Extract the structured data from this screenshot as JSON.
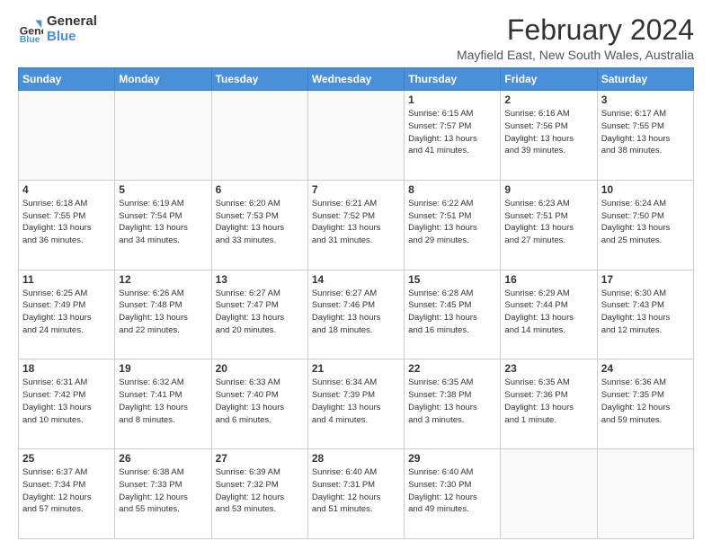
{
  "logo": {
    "line1": "General",
    "line2": "Blue"
  },
  "title": "February 2024",
  "subtitle": "Mayfield East, New South Wales, Australia",
  "header_days": [
    "Sunday",
    "Monday",
    "Tuesday",
    "Wednesday",
    "Thursday",
    "Friday",
    "Saturday"
  ],
  "weeks": [
    [
      {
        "day": "",
        "info": ""
      },
      {
        "day": "",
        "info": ""
      },
      {
        "day": "",
        "info": ""
      },
      {
        "day": "",
        "info": ""
      },
      {
        "day": "1",
        "info": "Sunrise: 6:15 AM\nSunset: 7:57 PM\nDaylight: 13 hours\nand 41 minutes."
      },
      {
        "day": "2",
        "info": "Sunrise: 6:16 AM\nSunset: 7:56 PM\nDaylight: 13 hours\nand 39 minutes."
      },
      {
        "day": "3",
        "info": "Sunrise: 6:17 AM\nSunset: 7:55 PM\nDaylight: 13 hours\nand 38 minutes."
      }
    ],
    [
      {
        "day": "4",
        "info": "Sunrise: 6:18 AM\nSunset: 7:55 PM\nDaylight: 13 hours\nand 36 minutes."
      },
      {
        "day": "5",
        "info": "Sunrise: 6:19 AM\nSunset: 7:54 PM\nDaylight: 13 hours\nand 34 minutes."
      },
      {
        "day": "6",
        "info": "Sunrise: 6:20 AM\nSunset: 7:53 PM\nDaylight: 13 hours\nand 33 minutes."
      },
      {
        "day": "7",
        "info": "Sunrise: 6:21 AM\nSunset: 7:52 PM\nDaylight: 13 hours\nand 31 minutes."
      },
      {
        "day": "8",
        "info": "Sunrise: 6:22 AM\nSunset: 7:51 PM\nDaylight: 13 hours\nand 29 minutes."
      },
      {
        "day": "9",
        "info": "Sunrise: 6:23 AM\nSunset: 7:51 PM\nDaylight: 13 hours\nand 27 minutes."
      },
      {
        "day": "10",
        "info": "Sunrise: 6:24 AM\nSunset: 7:50 PM\nDaylight: 13 hours\nand 25 minutes."
      }
    ],
    [
      {
        "day": "11",
        "info": "Sunrise: 6:25 AM\nSunset: 7:49 PM\nDaylight: 13 hours\nand 24 minutes."
      },
      {
        "day": "12",
        "info": "Sunrise: 6:26 AM\nSunset: 7:48 PM\nDaylight: 13 hours\nand 22 minutes."
      },
      {
        "day": "13",
        "info": "Sunrise: 6:27 AM\nSunset: 7:47 PM\nDaylight: 13 hours\nand 20 minutes."
      },
      {
        "day": "14",
        "info": "Sunrise: 6:27 AM\nSunset: 7:46 PM\nDaylight: 13 hours\nand 18 minutes."
      },
      {
        "day": "15",
        "info": "Sunrise: 6:28 AM\nSunset: 7:45 PM\nDaylight: 13 hours\nand 16 minutes."
      },
      {
        "day": "16",
        "info": "Sunrise: 6:29 AM\nSunset: 7:44 PM\nDaylight: 13 hours\nand 14 minutes."
      },
      {
        "day": "17",
        "info": "Sunrise: 6:30 AM\nSunset: 7:43 PM\nDaylight: 13 hours\nand 12 minutes."
      }
    ],
    [
      {
        "day": "18",
        "info": "Sunrise: 6:31 AM\nSunset: 7:42 PM\nDaylight: 13 hours\nand 10 minutes."
      },
      {
        "day": "19",
        "info": "Sunrise: 6:32 AM\nSunset: 7:41 PM\nDaylight: 13 hours\nand 8 minutes."
      },
      {
        "day": "20",
        "info": "Sunrise: 6:33 AM\nSunset: 7:40 PM\nDaylight: 13 hours\nand 6 minutes."
      },
      {
        "day": "21",
        "info": "Sunrise: 6:34 AM\nSunset: 7:39 PM\nDaylight: 13 hours\nand 4 minutes."
      },
      {
        "day": "22",
        "info": "Sunrise: 6:35 AM\nSunset: 7:38 PM\nDaylight: 13 hours\nand 3 minutes."
      },
      {
        "day": "23",
        "info": "Sunrise: 6:35 AM\nSunset: 7:36 PM\nDaylight: 13 hours\nand 1 minute."
      },
      {
        "day": "24",
        "info": "Sunrise: 6:36 AM\nSunset: 7:35 PM\nDaylight: 12 hours\nand 59 minutes."
      }
    ],
    [
      {
        "day": "25",
        "info": "Sunrise: 6:37 AM\nSunset: 7:34 PM\nDaylight: 12 hours\nand 57 minutes."
      },
      {
        "day": "26",
        "info": "Sunrise: 6:38 AM\nSunset: 7:33 PM\nDaylight: 12 hours\nand 55 minutes."
      },
      {
        "day": "27",
        "info": "Sunrise: 6:39 AM\nSunset: 7:32 PM\nDaylight: 12 hours\nand 53 minutes."
      },
      {
        "day": "28",
        "info": "Sunrise: 6:40 AM\nSunset: 7:31 PM\nDaylight: 12 hours\nand 51 minutes."
      },
      {
        "day": "29",
        "info": "Sunrise: 6:40 AM\nSunset: 7:30 PM\nDaylight: 12 hours\nand 49 minutes."
      },
      {
        "day": "",
        "info": ""
      },
      {
        "day": "",
        "info": ""
      }
    ]
  ]
}
